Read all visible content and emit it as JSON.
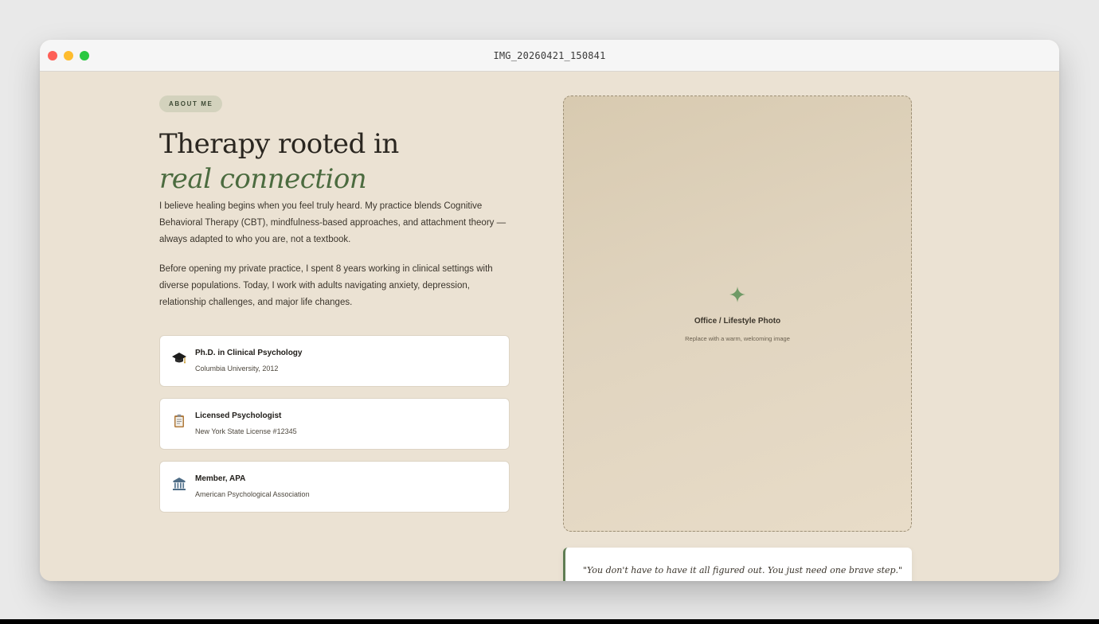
{
  "window": {
    "title": "IMG_20260421_150841"
  },
  "about": {
    "eyebrow": "ABOUT ME",
    "heading_line1": "Therapy rooted in",
    "heading_line2": "real connection",
    "paragraph1": "I believe healing begins when you feel truly heard. My practice blends Cognitive Behavioral Therapy (CBT), mindfulness-based approaches, and attachment theory — always adapted to who you are, not a textbook.",
    "paragraph2": "Before opening my private practice, I spent 8 years working in clinical settings with diverse populations. Today, I work with adults navigating anxiety, depression, relationship challenges, and major life changes."
  },
  "credentials": [
    {
      "icon": "graduation-cap-icon",
      "title": "Ph.D. in Clinical Psychology",
      "subtitle": "Columbia University, 2012"
    },
    {
      "icon": "clipboard-icon",
      "title": "Licensed Psychologist",
      "subtitle": "New York State License #12345"
    },
    {
      "icon": "institution-icon",
      "title": "Member, APA",
      "subtitle": "American Psychological Association"
    }
  ],
  "photo": {
    "label": "Office / Lifestyle Photo",
    "caption": "Replace with a warm, welcoming image",
    "icon": "sparkle-icon"
  },
  "quote": {
    "text": "\"You don't have to have it all figured out. You just need one brave step.\""
  },
  "colors": {
    "page_background": "#ebe2d3",
    "accent_green": "#4b6b3f",
    "eyebrow_background": "#d3d2bd",
    "card_background": "#ffffff"
  }
}
